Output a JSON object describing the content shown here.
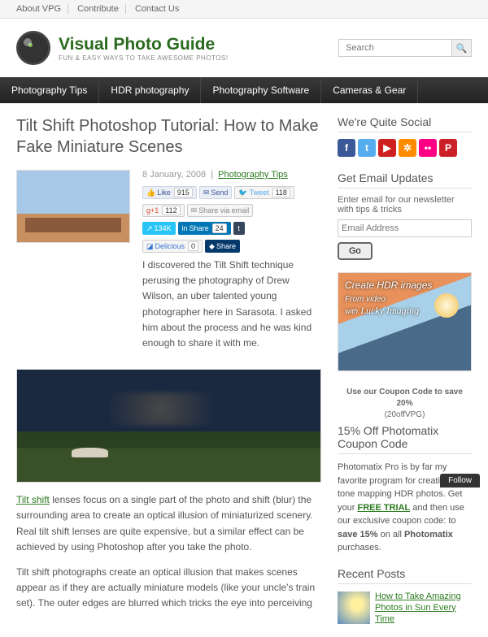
{
  "topnav": {
    "about": "About VPG",
    "contribute": "Contribute",
    "contact": "Contact Us"
  },
  "logo": {
    "title": "Visual Photo Guide",
    "subtitle": "FUN & EASY WAYS TO TAKE AWESOME PHOTOS!"
  },
  "search": {
    "placeholder": "Search"
  },
  "mainnav": {
    "tips": "Photography Tips",
    "hdr": "HDR photography",
    "soft": "Photography Software",
    "gear": "Cameras & Gear"
  },
  "article": {
    "title": "Tilt Shift Photoshop Tutorial: How to Make Fake Miniature Scenes",
    "date": "8 January, 2008",
    "category": "Photography Tips",
    "intro": "I discovered the Tilt Shift technique perusing the photography of Drew Wilson, an uber talented young photographer here in Sarasota. I asked him about the process and he was kind enough to share it with me.",
    "p2a": "Tilt shift",
    "p2b": " lenses focus on a single part of the photo and shift (blur) the surrounding area to create an optical illusion of miniaturized scenery. Real tilt shift lenses are quite expensive, but a similar effect can be achieved by using Photoshop after you take the photo.",
    "p3": "Tilt shift photographs create an optical illusion that makes scenes appear as if they are actually miniature models (like your uncle's train set). The outer edges are blurred which tricks the eye into perceiving"
  },
  "social": {
    "like": "Like",
    "like_n": "915",
    "send": "Send",
    "tweet": "Tweet",
    "tweet_n": "118",
    "g_n": "112",
    "email": "Share via email",
    "share_k": "134K",
    "linkedin": "Share",
    "linkedin_n": "24",
    "delicious": "Delicious",
    "del_n": "0",
    "dshare": "Share"
  },
  "sidebar": {
    "social_h": "We're Quite Social",
    "email_h": "Get Email Updates",
    "email_lead": "Enter email for our newsletter with tips & tricks",
    "email_ph": "Email Address",
    "go": "Go",
    "ad_l1": "Create HDR images",
    "ad_l2": "From video",
    "ad_l3": "with",
    "ad_brand": "Lucky Imaging",
    "ad_cap1": "Use our Coupon Code to save 20%",
    "ad_cap2": "(20offVPG)",
    "promo_h": "15% Off Photomatix Coupon Code",
    "promo_txt1": "Photomatix Pro is by far my favorite program for creating and tone mapping HDR photos. Get your ",
    "promo_link": "FREE TRIAL",
    "promo_txt2": " and then use our exclusive coupon code: to ",
    "promo_bold": "save 15%",
    "promo_txt3": " on all ",
    "promo_bold2": "Photomatix",
    "promo_txt4": " purchases.",
    "recent_h": "Recent Posts",
    "recent1": "How to Take Amazing Photos in Sun Every Time"
  },
  "follow": "Follow"
}
